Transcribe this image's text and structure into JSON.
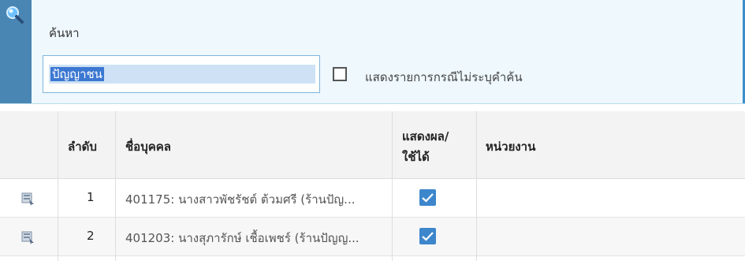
{
  "search": {
    "title": "ค้นหา",
    "input_value": "ปัญญาชน",
    "checkbox_label": "แสดงรายการกรณีไม่ระบุคำค้น",
    "icon": "magnifier-icon"
  },
  "grid": {
    "headers": {
      "order": "ลำดับ",
      "name": "ชื่อบุคคล",
      "display_line1": "แสดงผล/",
      "display_line2": "ใช้ได้",
      "unit": "หน่วยงาน"
    },
    "rows": [
      {
        "order": "1",
        "name": "401175: นางสาวพัชรัชต์ ต้วมศรี (ร้านปัญ...",
        "checked": true,
        "unit": ""
      },
      {
        "order": "2",
        "name": "401203: นางสุภารักษ์ เชื้อเพชร์ (ร้านปัญญ...",
        "checked": true,
        "unit": ""
      }
    ],
    "row_icon": "row-select-icon"
  },
  "colors": {
    "accent": "#4a86b4",
    "checkbox_checked": "#3d86cc",
    "panel_bg": "#eef8fd"
  }
}
